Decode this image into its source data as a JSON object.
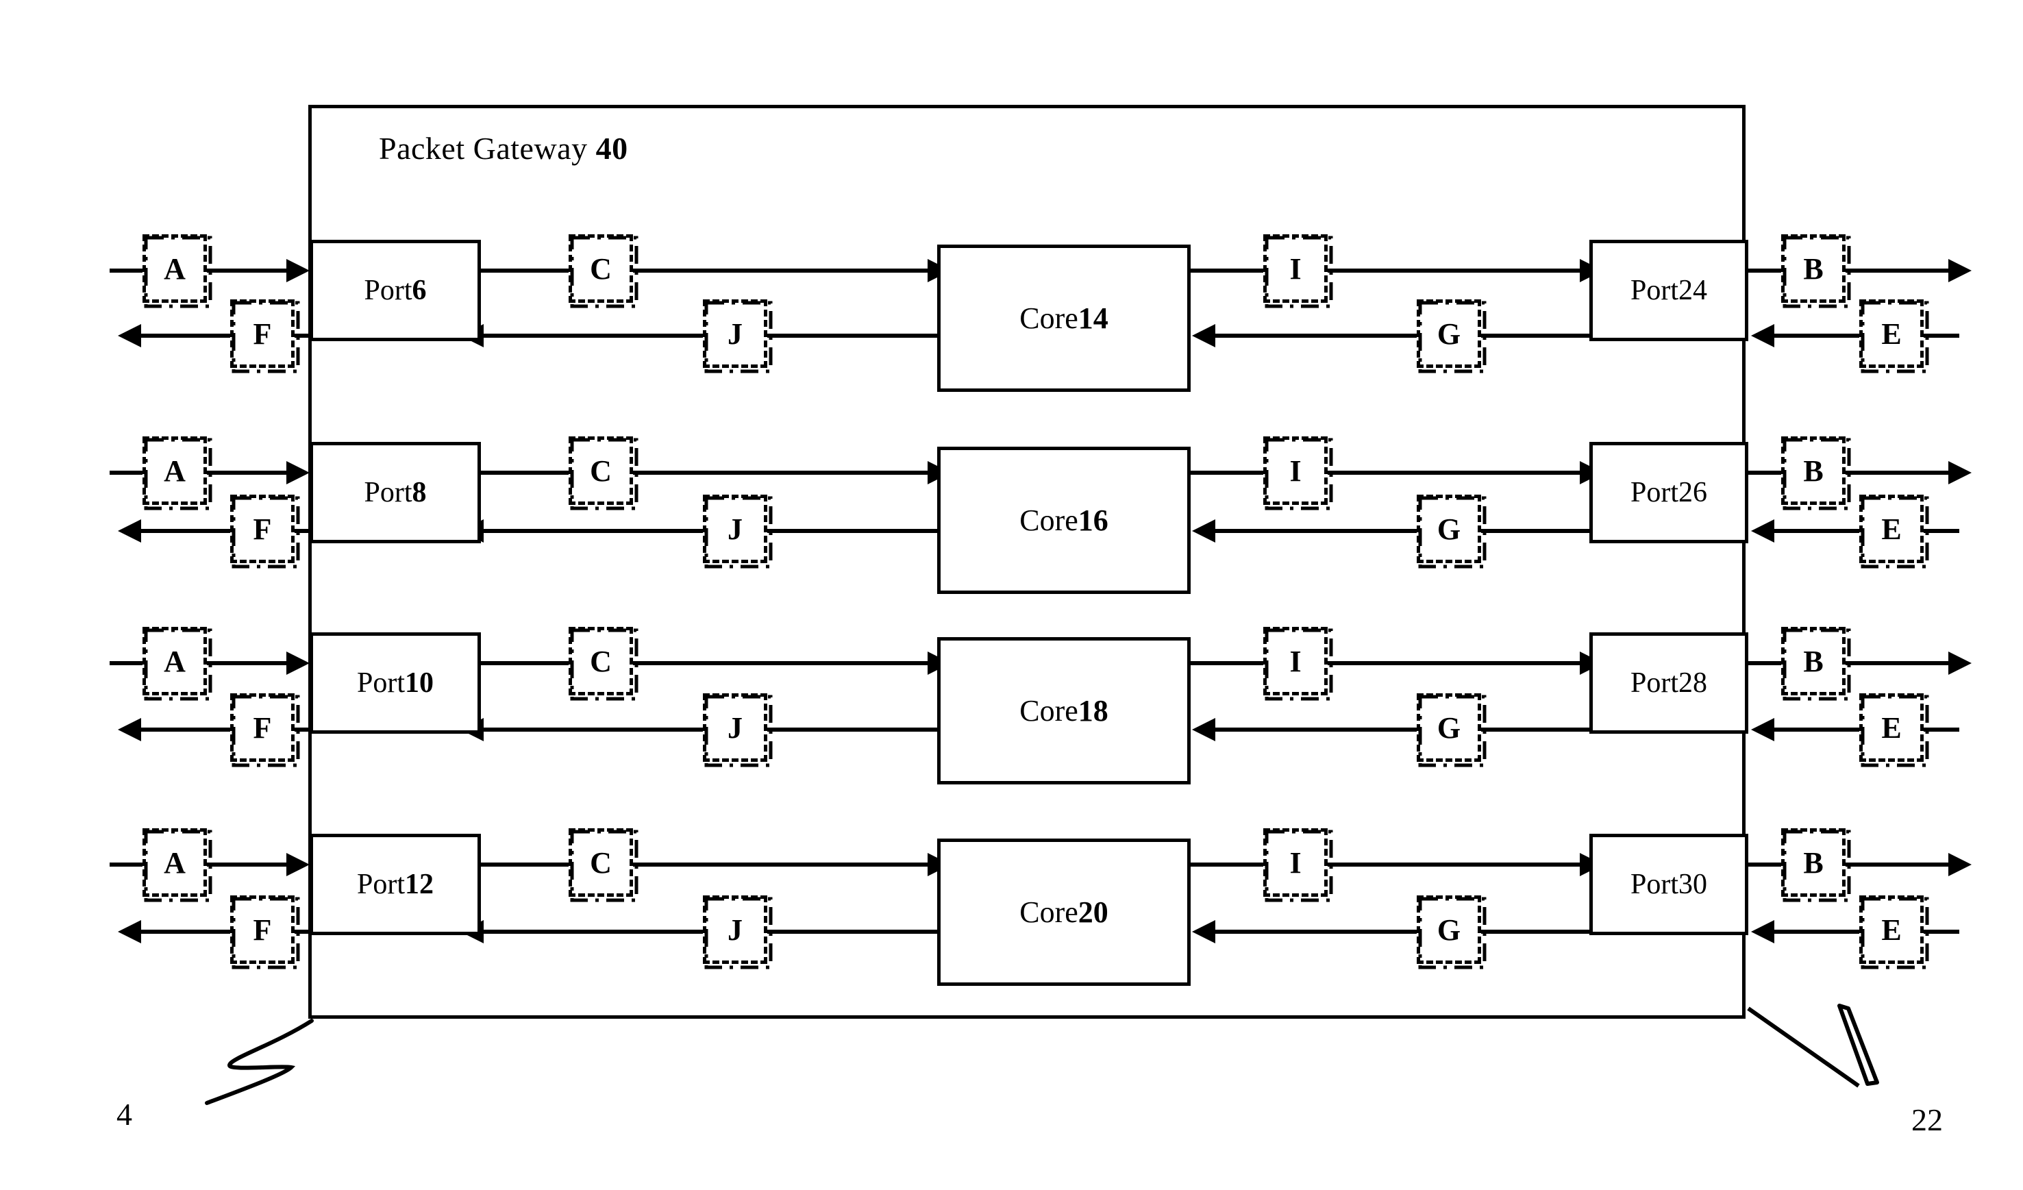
{
  "figure": {
    "title_text": "Packet Gateway ",
    "title_number": "40"
  },
  "rows": [
    {
      "port_left": "Port ",
      "port_left_num": "6",
      "core": "Core ",
      "core_num": "14",
      "port_right": "Port ",
      "port_right_num": "24",
      "labels": {
        "left_in": "A",
        "left_out": "F",
        "inner_in": "C",
        "inner_out": "J",
        "outer_in": "I",
        "outer_out": "G",
        "right_in": "B",
        "right_out": "E"
      }
    },
    {
      "port_left": "Port ",
      "port_left_num": "8",
      "core": "Core ",
      "core_num": "16",
      "port_right": "Port ",
      "port_right_num": "26",
      "labels": {
        "left_in": "A",
        "left_out": "F",
        "inner_in": "C",
        "inner_out": "J",
        "outer_in": "I",
        "outer_out": "G",
        "right_in": "B",
        "right_out": "E"
      }
    },
    {
      "port_left": "Port ",
      "port_left_num": "10",
      "core": "Core ",
      "core_num": "18",
      "port_right": "Port ",
      "port_right_num": "28",
      "labels": {
        "left_in": "A",
        "left_out": "F",
        "inner_in": "C",
        "inner_out": "J",
        "outer_in": "I",
        "outer_out": "G",
        "right_in": "B",
        "right_out": "E"
      }
    },
    {
      "port_left": "Port ",
      "port_left_num": "12",
      "core": "Core ",
      "core_num": "20",
      "port_right": "Port ",
      "port_right_num": "30",
      "labels": {
        "left_in": "A",
        "left_out": "F",
        "inner_in": "C",
        "inner_out": "J",
        "outer_in": "I",
        "outer_out": "G",
        "right_in": "B",
        "right_out": "E"
      }
    }
  ],
  "reference_numerals": {
    "left": "4",
    "right": "22"
  },
  "colors": {
    "stroke": "#000000",
    "background": "#ffffff"
  }
}
